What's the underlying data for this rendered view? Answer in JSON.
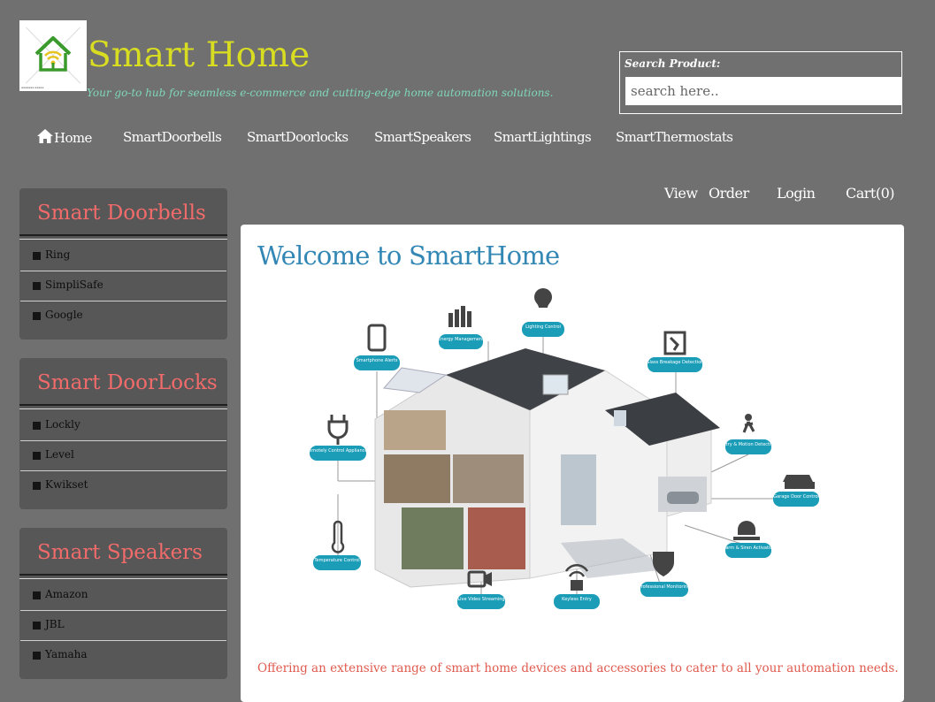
{
  "brand": {
    "title": "Smart Home",
    "tagline": "Your go-to hub for seamless e-commerce and cutting-edge home automation solutions.",
    "logo_icon": "home-wifi-icon",
    "title_color": "#d8dd22",
    "tagline_color": "#7fd6b8"
  },
  "search": {
    "label": "Search Product:",
    "placeholder": "search here.."
  },
  "nav": {
    "items": [
      {
        "label": "Home",
        "icon": "home-icon"
      },
      {
        "label": "SmartDoorbells"
      },
      {
        "label": "SmartDoorlocks"
      },
      {
        "label": "SmartSpeakers"
      },
      {
        "label": "SmartLightings"
      },
      {
        "label": "SmartThermostats"
      }
    ]
  },
  "top_links": {
    "view": "View",
    "order": "Order",
    "login": "Login",
    "cart": "Cart(0)"
  },
  "sidebar": [
    {
      "title": "Smart Doorbells",
      "items": [
        "Ring",
        "SimpliSafe",
        "Google"
      ]
    },
    {
      "title": "Smart DoorLocks",
      "items": [
        "Lockly",
        "Level",
        "Kwikset"
      ]
    },
    {
      "title": "Smart Speakers",
      "items": [
        "Amazon",
        "JBL",
        "Yamaha"
      ]
    }
  ],
  "main": {
    "heading": "Welcome to SmartHome",
    "offer_text": "Offering an extensive range of smart home devices and accessories to cater to all your automation needs.",
    "heading_color": "#3387b4",
    "offer_color": "#e05b4f",
    "hero_labels": {
      "lighting": "Lighting Control",
      "energy": "Energy Management",
      "smartphone": "Smartphone Alerts",
      "glass": "Glass Breakage Detection",
      "entry_motion": "Entry & Motion Detection",
      "remote": "Remotely Control Appliances",
      "garage": "Garage Door Control",
      "alarm": "Alarm & Siren Activation",
      "temperature": "Temperature Control",
      "professional": "Professional Monitoring",
      "video": "Live Video Streaming",
      "keyless": "Keyless Entry"
    }
  },
  "colors": {
    "page_bg": "#707070",
    "sidebar_bg": "#575757",
    "sidebar_title": "#f26b6b",
    "badge": "#1b9db8"
  }
}
